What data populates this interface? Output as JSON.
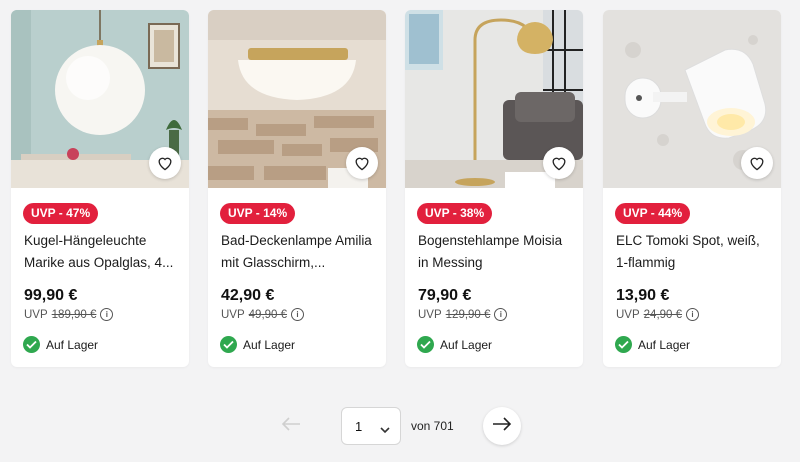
{
  "products": [
    {
      "badge": "UVP - 47%",
      "title": "Kugel-Hängeleuchte Marike aus Opalglas, 4...",
      "price": "99,90 €",
      "uvp_label": "UVP",
      "uvp_price": "189,90 €",
      "stock": "Auf Lager",
      "image_icon": "pendant-globe-lamp"
    },
    {
      "badge": "UVP - 14%",
      "title": "Bad-Deckenlampe Amilia mit Glasschirm,...",
      "price": "42,90 €",
      "uvp_label": "UVP",
      "uvp_price": "49,90 €",
      "stock": "Auf Lager",
      "image_icon": "ceiling-lamp"
    },
    {
      "badge": "UVP - 38%",
      "title": "Bogenstehlampe Moisia in Messing",
      "price": "79,90 €",
      "uvp_label": "UVP",
      "uvp_price": "129,90 €",
      "stock": "Auf Lager",
      "image_icon": "arc-floor-lamp"
    },
    {
      "badge": "UVP - 44%",
      "title": "ELC Tomoki Spot, weiß, 1-flammig",
      "price": "13,90 €",
      "uvp_label": "UVP",
      "uvp_price": "24,90 €",
      "stock": "Auf Lager",
      "image_icon": "wall-spot-lamp"
    }
  ],
  "pagination": {
    "current_page": "1",
    "of_label": "von 701",
    "prev_icon": "arrow-left-icon",
    "next_icon": "arrow-right-icon"
  },
  "colors": {
    "badge": "#e2203d",
    "in_stock": "#2fa84f",
    "background": "#f3f3f4"
  }
}
